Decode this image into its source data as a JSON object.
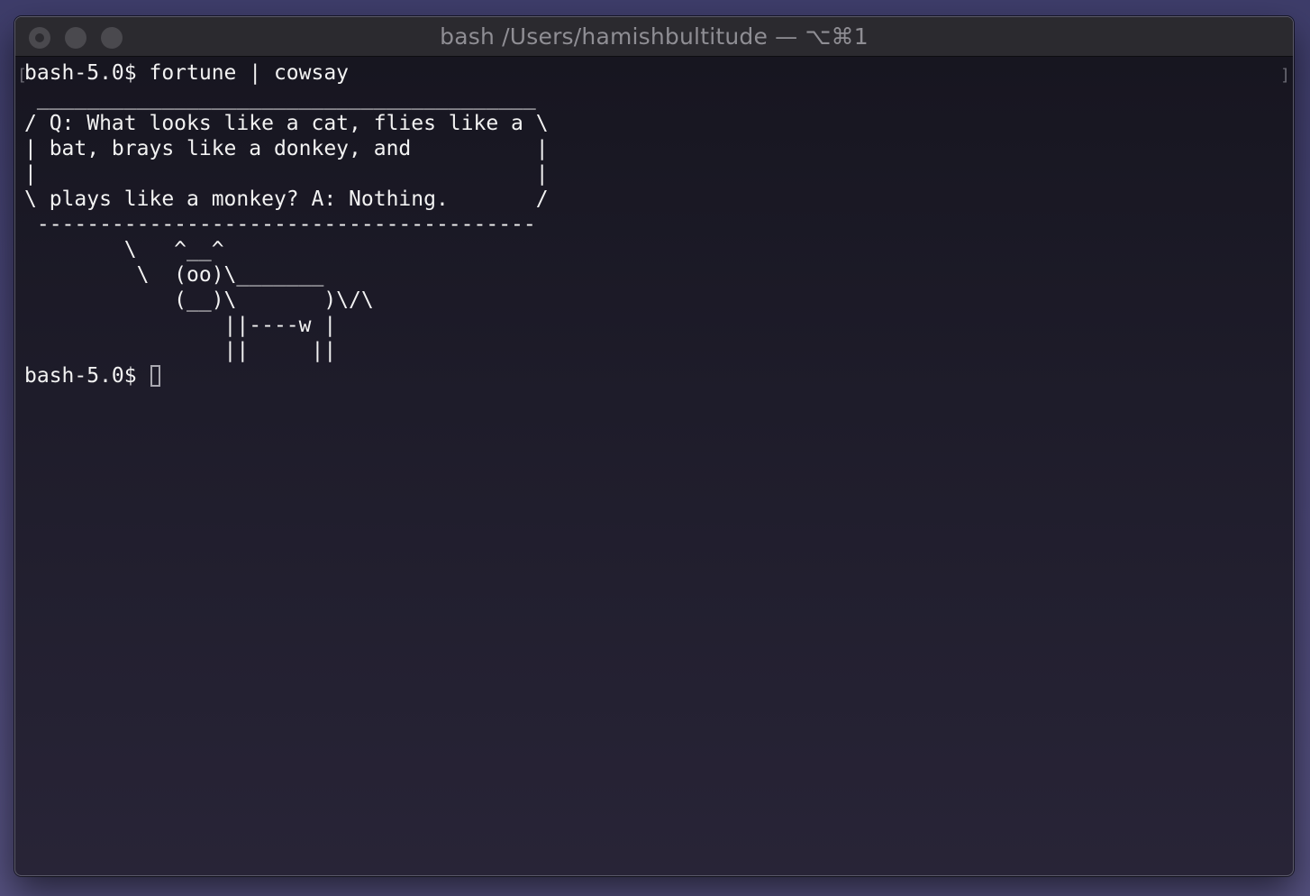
{
  "window": {
    "title": "bash /Users/hamishbultitude — ⌥⌘1"
  },
  "terminal": {
    "bracket_left": "[",
    "bracket_right": "]",
    "output": "bash-5.0$ fortune | cowsay\n ________________________________________\n/ Q: What looks like a cat, flies like a \\\n| bat, brays like a donkey, and          |\n|                                        |\n\\ plays like a monkey? A: Nothing.       /\n ----------------------------------------\n        \\   ^__^\n         \\  (oo)\\_______\n            (__)\\       )\\/\\\n                ||----w |\n                ||     ||",
    "prompt": "bash-5.0$ "
  }
}
